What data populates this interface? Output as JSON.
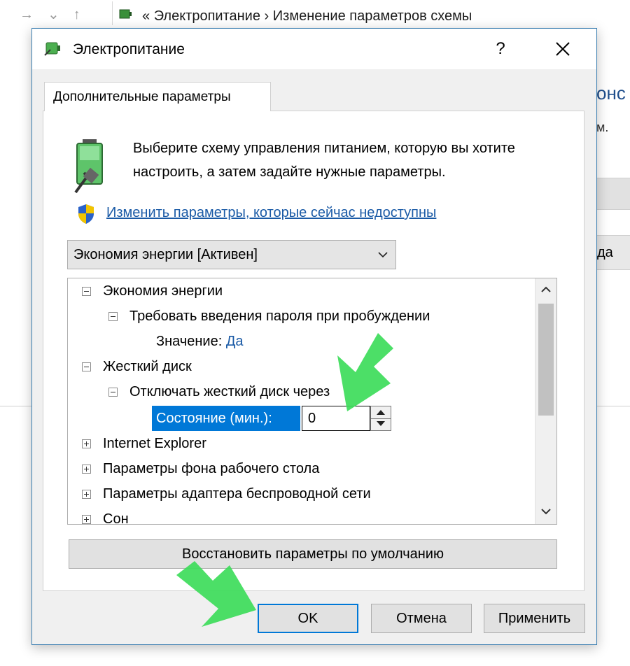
{
  "background": {
    "breadcrumb_sep": "«",
    "crumb1": "Электропитание",
    "crumb_arrow": "›",
    "crumb2": "Изменение параметров схемы",
    "right_fragment1": "онс",
    "right_fragment2": "м.",
    "right_fragment3": "да"
  },
  "dialog": {
    "title": "Электропитание",
    "help_label": "?",
    "close_label": "✕",
    "tab_label": "Дополнительные параметры",
    "description": "Выберите схему управления питанием, которую вы хотите настроить, а затем задайте нужные параметры.",
    "change_link": "Изменить параметры, которые сейчас недоступны",
    "scheme_selected": "Экономия энергии [Активен]",
    "tree": {
      "group1": "Экономия энергии",
      "group1_child": "Требовать введения пароля при пробуждении",
      "value_label": "Значение:",
      "value": "Да",
      "group2": "Жесткий диск",
      "group2_child": "Отключать жесткий диск через",
      "state_label": "Состояние (мин.):",
      "state_value": "0",
      "item3": "Internet Explorer",
      "item4": "Параметры фона рабочего стола",
      "item5": "Параметры адаптера беспроводной сети",
      "item6": "Сон"
    },
    "restore_button": "Восстановить параметры по умолчанию",
    "ok_button": "OK",
    "cancel_button": "Отмена",
    "apply_button": "Применить"
  },
  "colors": {
    "accent": "#0078d7",
    "link": "#1a5aa6",
    "arrow_green": "#3ddc5a"
  }
}
